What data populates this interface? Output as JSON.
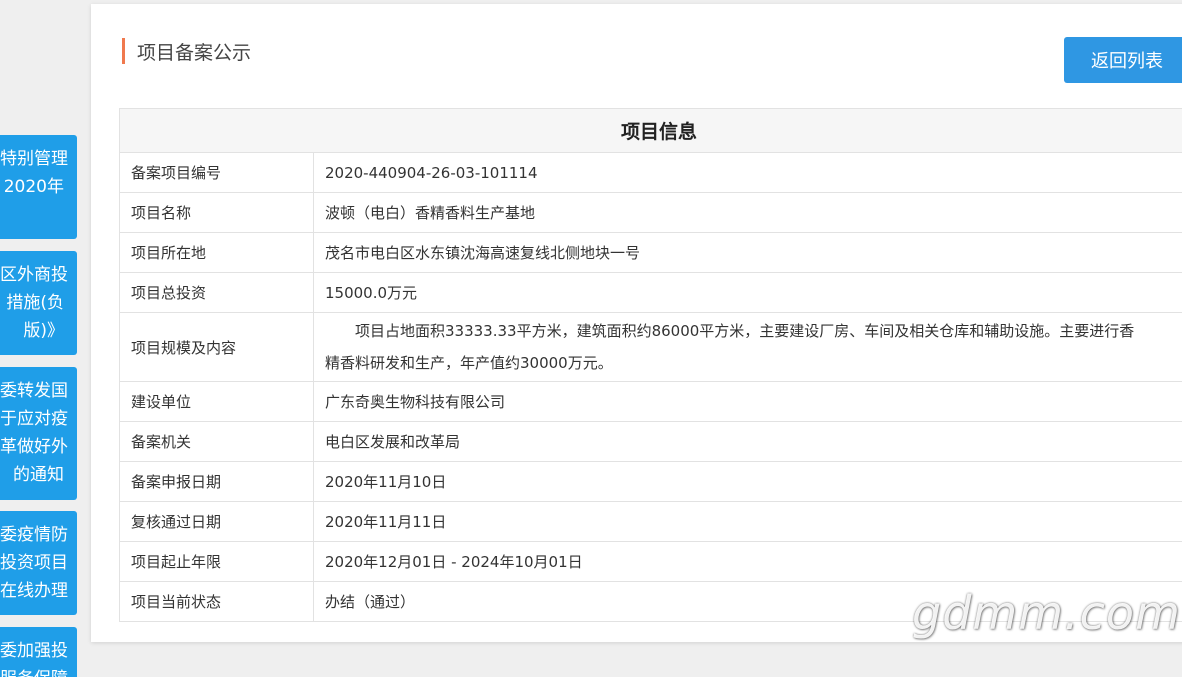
{
  "sidebar": {
    "tiles": [
      {
        "lines": [
          "特别管理",
          "2020年"
        ]
      },
      {
        "lines": [
          "区外商投",
          "措施(负",
          "版)》"
        ]
      },
      {
        "lines": [
          "委转发国",
          "于应对疫",
          "革做好外",
          "的通知"
        ]
      },
      {
        "lines": [
          "委疫情防",
          "投资项目",
          "在线办理"
        ]
      },
      {
        "lines": [
          "委加强投",
          "服务保障"
        ]
      }
    ]
  },
  "section": {
    "title": "项目备案公示"
  },
  "back_button": {
    "label": "返回列表"
  },
  "table": {
    "header": "项目信息",
    "rows": [
      {
        "label": "备案项目编号",
        "value": "2020-440904-26-03-101114"
      },
      {
        "label": "项目名称",
        "value": "波顿（电白）香精香料生产基地"
      },
      {
        "label": "项目所在地",
        "value": "茂名市电白区水东镇沈海高速复线北侧地块一号"
      },
      {
        "label": "项目总投资",
        "value": "15000.0万元"
      },
      {
        "label": "项目规模及内容",
        "value_line1": "项目占地面积33333.33平方米，建筑面积约86000平方米，主要建设厂房、车间及相关仓库和辅助设施。主要进行香",
        "value_line2": "精香料研发和生产，年产值约30000万元。"
      },
      {
        "label": "建设单位",
        "value": "广东奇奥生物科技有限公司"
      },
      {
        "label": "备案机关",
        "value": "电白区发展和改革局"
      },
      {
        "label": "备案申报日期",
        "value": "2020年11月10日"
      },
      {
        "label": "复核通过日期",
        "value": "2020年11月11日"
      },
      {
        "label": "项目起止年限",
        "value": "2020年12月01日 - 2024年10月01日"
      },
      {
        "label": "项目当前状态",
        "value": "办结（通过）"
      }
    ]
  },
  "watermark": {
    "text": "gdmm.com"
  }
}
